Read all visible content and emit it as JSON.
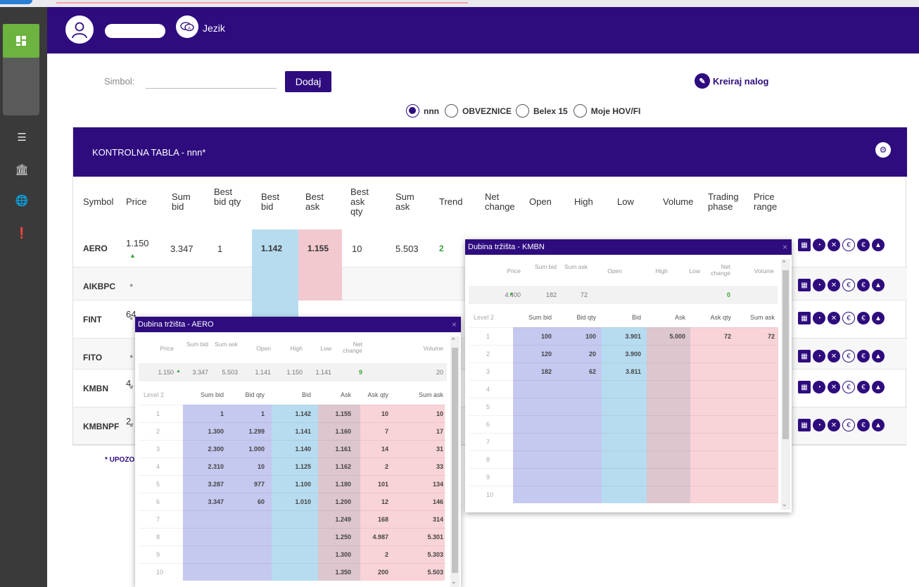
{
  "topbar": {
    "language_label": "Jezik"
  },
  "form": {
    "symbol_label": "Simbol:",
    "symbol_value": "",
    "add_label": "Dodaj",
    "create_order_label": "Kreiraj nalog"
  },
  "radios": [
    {
      "label": "nnn",
      "selected": true
    },
    {
      "label": "OBVEZNICE",
      "selected": false
    },
    {
      "label": "Belex 15",
      "selected": false
    },
    {
      "label": "Moje HOV/FI",
      "selected": false
    }
  ],
  "panel": {
    "title": "KONTROLNA TABLA - nnn*",
    "columns": [
      "Symbol",
      "Price",
      "Sum bid",
      "Best bid qty",
      "Best bid",
      "Best ask",
      "Best ask qty",
      "Sum ask",
      "Trend",
      "Net change",
      "Open",
      "High",
      "Low",
      "Volume",
      "Trading phase",
      "Price range"
    ],
    "rows": [
      {
        "symbol": "AERO",
        "price": "1.150",
        "sum_bid": "3.347",
        "best_bid_qty": "1",
        "best_bid": "1.142",
        "best_ask": "1.155",
        "best_ask_qty": "10",
        "sum_ask": "5.503",
        "trend": "2"
      },
      {
        "symbol": "AIKBPC",
        "price": "",
        "sum_bid": "",
        "best_bid_qty": "",
        "best_bid": "",
        "best_ask": "",
        "best_ask_qty": "",
        "sum_ask": "",
        "trend": ""
      },
      {
        "symbol": "FINT",
        "price": "64",
        "sum_bid": "",
        "best_bid_qty": "",
        "best_bid": "",
        "best_ask": "",
        "best_ask_qty": "",
        "sum_ask": "",
        "trend": ""
      },
      {
        "symbol": "FITO",
        "price": "",
        "sum_bid": "",
        "best_bid_qty": "",
        "best_bid": "",
        "best_ask": "",
        "best_ask_qty": "",
        "sum_ask": "",
        "trend": ""
      },
      {
        "symbol": "KMBN",
        "price": "4.",
        "sum_bid": "",
        "best_bid_qty": "",
        "best_bid": "",
        "best_ask": "",
        "best_ask_qty": "",
        "sum_ask": "",
        "trend": ""
      },
      {
        "symbol": "KMBNPF",
        "price": "2.",
        "sum_bid": "",
        "best_bid_qty": "",
        "best_bid": "",
        "best_ask": "",
        "best_ask_qty": "",
        "sum_ask": "",
        "trend": ""
      }
    ],
    "warning": "* UPOZO"
  },
  "depth_aero": {
    "title": "Dubina tržišta - AERO",
    "close": "×",
    "summary_headers": [
      "Price",
      "Sum bid",
      "Sum ask",
      "Open",
      "High",
      "Low",
      "Net change",
      "Volume"
    ],
    "summary_values": [
      "1.150",
      "3.347",
      "5.503",
      "1.141",
      "1.150",
      "1.141",
      "9",
      "20"
    ],
    "level_headers": [
      "Level 2",
      "Sum bid",
      "Bid qty",
      "Bid",
      "Ask",
      "Ask qty",
      "Sum ask"
    ],
    "levels": [
      [
        "1",
        "1",
        "1",
        "1.142",
        "1.155",
        "10",
        "10"
      ],
      [
        "2",
        "1.300",
        "1.299",
        "1.141",
        "1.160",
        "7",
        "17"
      ],
      [
        "3",
        "2.300",
        "1.000",
        "1.140",
        "1.161",
        "14",
        "31"
      ],
      [
        "4",
        "2.310",
        "10",
        "1.125",
        "1.162",
        "2",
        "33"
      ],
      [
        "5",
        "3.287",
        "977",
        "1.100",
        "1.180",
        "101",
        "134"
      ],
      [
        "6",
        "3.347",
        "60",
        "1.010",
        "1.200",
        "12",
        "146"
      ],
      [
        "7",
        "",
        "",
        "",
        "1.249",
        "168",
        "314"
      ],
      [
        "8",
        "",
        "",
        "",
        "1.250",
        "4.987",
        "5.301"
      ],
      [
        "9",
        "",
        "",
        "",
        "1.300",
        "2",
        "5.303"
      ],
      [
        "10",
        "",
        "",
        "",
        "1.350",
        "200",
        "5.503"
      ]
    ]
  },
  "depth_kmbn": {
    "title": "Dubina tržišta - KMBN",
    "close": "×",
    "summary_headers": [
      "Price",
      "Sum bid",
      "Sum ask",
      "Open",
      "High",
      "Low",
      "Net change",
      "Volume"
    ],
    "summary_values": [
      "4.400",
      "182",
      "72",
      "",
      "",
      "",
      "0",
      ""
    ],
    "level_headers": [
      "Level 2",
      "Sum bid",
      "Bid qty",
      "Bid",
      "Ask",
      "Ask qty",
      "Sum ask"
    ],
    "levels": [
      [
        "1",
        "100",
        "100",
        "3.901",
        "5.000",
        "72",
        "72"
      ],
      [
        "2",
        "120",
        "20",
        "3.900",
        "",
        "",
        ""
      ],
      [
        "3",
        "182",
        "62",
        "3.811",
        "",
        "",
        ""
      ],
      [
        "4",
        "",
        "",
        "",
        "",
        "",
        ""
      ],
      [
        "5",
        "",
        "",
        "",
        "",
        "",
        ""
      ],
      [
        "6",
        "",
        "",
        "",
        "",
        "",
        ""
      ],
      [
        "7",
        "",
        "",
        "",
        "",
        "",
        ""
      ],
      [
        "8",
        "",
        "",
        "",
        "",
        "",
        ""
      ],
      [
        "9",
        "",
        "",
        "",
        "",
        "",
        ""
      ],
      [
        "10",
        "",
        "",
        "",
        "",
        "",
        ""
      ]
    ]
  },
  "colors": {
    "primary": "#2e0c7e",
    "accent": "#6cb33f",
    "bid": "#b7dcf0",
    "ask": "#f1c9cf",
    "sum_bid": "#c5c8ef",
    "trend_up": "#3aa53a"
  }
}
